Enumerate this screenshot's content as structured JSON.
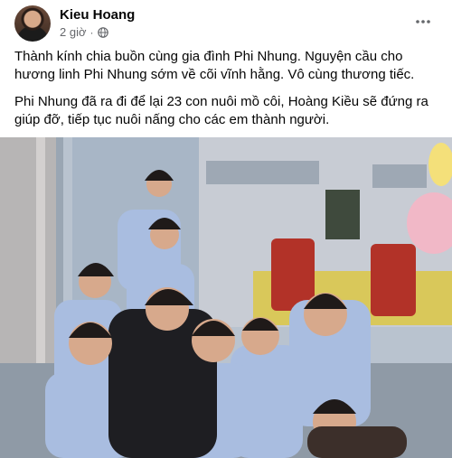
{
  "post": {
    "author": "Kieu Hoang",
    "time": "2 giờ",
    "separator": "·",
    "paragraphs": [
      "Thành kính chia buồn cùng gia đình Phi Nhung. Nguyện cầu cho hương linh Phi Nhung sớm về cõi vĩnh hằng. Vô cùng thương tiếc.",
      "Phi Nhung đã ra đi để lại 23 con nuôi mồ côi, Hoàng Kiều sẽ đứng ra giúp đỡ, tiếp tục nuôi nấng cho các em thành người."
    ]
  },
  "icons": {
    "privacy": "globe-icon",
    "menu": "more-options-icon"
  }
}
